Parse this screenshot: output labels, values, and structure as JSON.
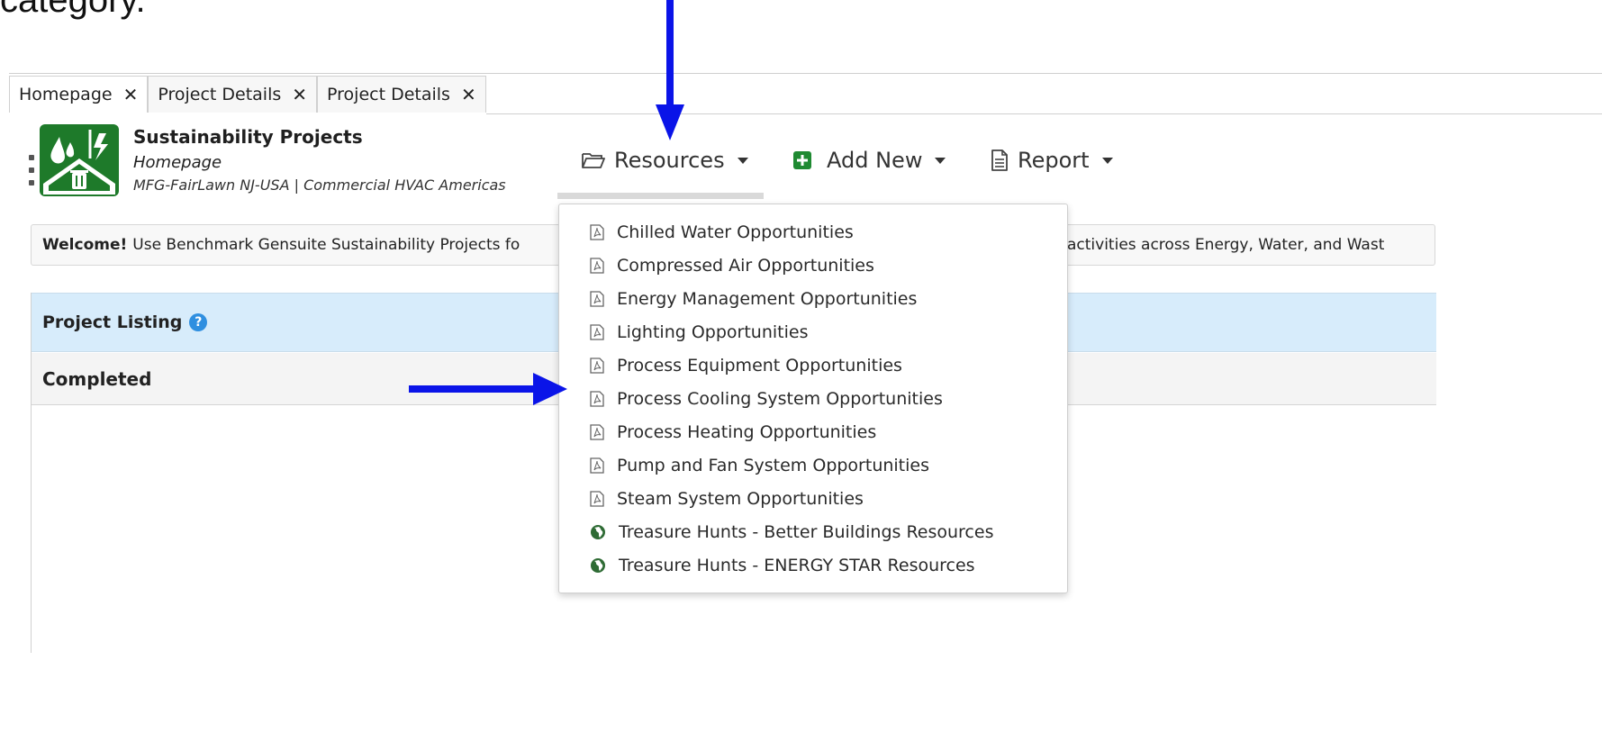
{
  "caption": "category.",
  "tabs": [
    {
      "label": "Homepage",
      "close": "✕"
    },
    {
      "label": "Project Details",
      "close": "✕"
    },
    {
      "label": "Project Details",
      "close": "✕"
    }
  ],
  "app": {
    "title": "Sustainability Projects",
    "page": "Homepage",
    "location": "MFG-FairLawn NJ-USA | Commercial HVAC Americas"
  },
  "nav": {
    "resources_label": "Resources",
    "add_new_label": "Add New",
    "report_label": "Report"
  },
  "welcome": {
    "bold": "Welcome!",
    "text": "Use Benchmark Gensuite Sustainability Projects fo",
    "tail": "activities across Energy, Water, and Wast"
  },
  "panel": {
    "title": "Project Listing",
    "help_icon": "question-circle-icon",
    "section": "Completed"
  },
  "resources_menu": [
    {
      "label": "Chilled Water Opportunities",
      "icon": "pdf-icon"
    },
    {
      "label": "Compressed Air Opportunities",
      "icon": "pdf-icon"
    },
    {
      "label": "Energy Management Opportunities",
      "icon": "pdf-icon"
    },
    {
      "label": "Lighting Opportunities",
      "icon": "pdf-icon"
    },
    {
      "label": "Process Equipment Opportunities",
      "icon": "pdf-icon"
    },
    {
      "label": "Process Cooling System Opportunities",
      "icon": "pdf-icon"
    },
    {
      "label": "Process Heating Opportunities",
      "icon": "pdf-icon"
    },
    {
      "label": "Pump and Fan System Opportunities",
      "icon": "pdf-icon"
    },
    {
      "label": "Steam System Opportunities",
      "icon": "pdf-icon"
    },
    {
      "label": "Treasure Hunts - Better Buildings Resources",
      "icon": "globe-icon"
    },
    {
      "label": "Treasure Hunts - ENERGY STAR Resources",
      "icon": "globe-icon"
    }
  ],
  "colors": {
    "annotation_arrow": "#0a14e8",
    "logo_green": "#1e7a2a",
    "add_new_green": "#1f8a32",
    "panel_header": "#d7ecfb",
    "help_blue": "#2f8fe0"
  }
}
